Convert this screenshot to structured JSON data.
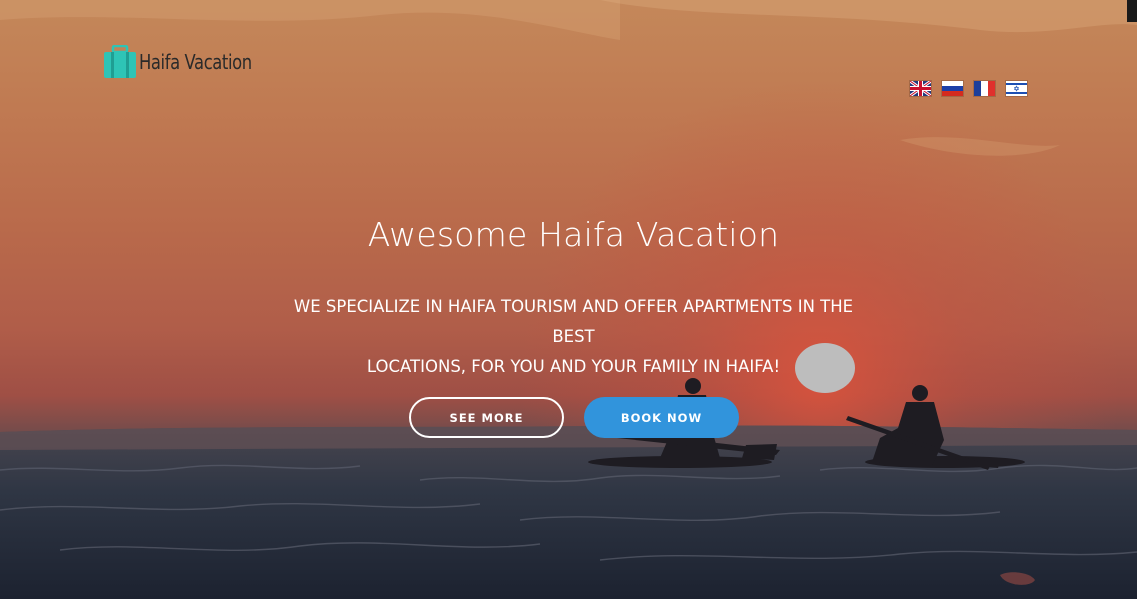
{
  "header": {
    "logo": {
      "text": "Haifa Vacation",
      "icon": "suitcase-icon",
      "color": "#2ec4b6"
    },
    "languages": [
      {
        "name": "English",
        "icon": "uk-flag-icon"
      },
      {
        "name": "Russian",
        "icon": "russia-flag-icon"
      },
      {
        "name": "French",
        "icon": "france-flag-icon"
      },
      {
        "name": "Hebrew",
        "icon": "israel-flag-icon"
      }
    ]
  },
  "hero": {
    "title": "Awesome Haifa Vacation",
    "subtitle_line1": "WE SPECIALIZE IN HAIFA TOURISM AND OFFER APARTMENTS IN THE BEST",
    "subtitle_line2": "LOCATIONS, FOR YOU AND YOUR FAMILY IN HAIFA!",
    "see_more_label": "SEE MORE",
    "book_now_label": "BOOK NOW",
    "accent_color": "#3194dc"
  }
}
